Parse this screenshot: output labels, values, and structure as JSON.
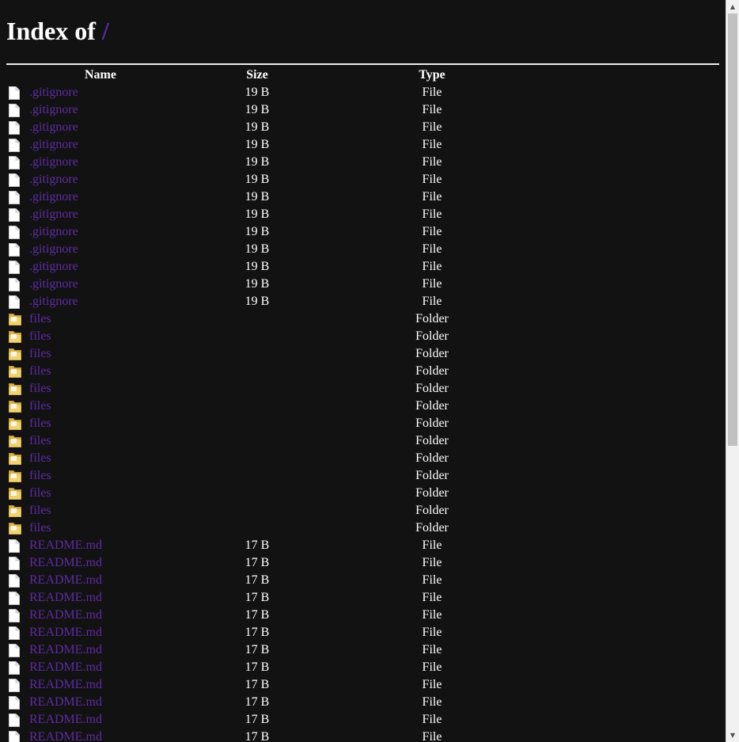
{
  "heading": {
    "prefix": "Index of ",
    "path": "/"
  },
  "columns": {
    "name": "Name",
    "size": "Size",
    "type": "Type"
  },
  "colors": {
    "background": "#121212",
    "link": "#5d2ca3",
    "text": "#ffffff",
    "folder_icon": "#f0d270"
  },
  "rows": [
    {
      "icon": "file-icon",
      "name": ".gitignore",
      "size": "19 B",
      "type": "File"
    },
    {
      "icon": "file-icon",
      "name": ".gitignore",
      "size": "19 B",
      "type": "File"
    },
    {
      "icon": "file-icon",
      "name": ".gitignore",
      "size": "19 B",
      "type": "File"
    },
    {
      "icon": "file-icon",
      "name": ".gitignore",
      "size": "19 B",
      "type": "File"
    },
    {
      "icon": "file-icon",
      "name": ".gitignore",
      "size": "19 B",
      "type": "File"
    },
    {
      "icon": "file-icon",
      "name": ".gitignore",
      "size": "19 B",
      "type": "File"
    },
    {
      "icon": "file-icon",
      "name": ".gitignore",
      "size": "19 B",
      "type": "File"
    },
    {
      "icon": "file-icon",
      "name": ".gitignore",
      "size": "19 B",
      "type": "File"
    },
    {
      "icon": "file-icon",
      "name": ".gitignore",
      "size": "19 B",
      "type": "File"
    },
    {
      "icon": "file-icon",
      "name": ".gitignore",
      "size": "19 B",
      "type": "File"
    },
    {
      "icon": "file-icon",
      "name": ".gitignore",
      "size": "19 B",
      "type": "File"
    },
    {
      "icon": "file-icon",
      "name": ".gitignore",
      "size": "19 B",
      "type": "File"
    },
    {
      "icon": "file-icon",
      "name": ".gitignore",
      "size": "19 B",
      "type": "File"
    },
    {
      "icon": "folder-icon",
      "name": "files",
      "size": "",
      "type": "Folder"
    },
    {
      "icon": "folder-icon",
      "name": "files",
      "size": "",
      "type": "Folder"
    },
    {
      "icon": "folder-icon",
      "name": "files",
      "size": "",
      "type": "Folder"
    },
    {
      "icon": "folder-icon",
      "name": "files",
      "size": "",
      "type": "Folder"
    },
    {
      "icon": "folder-icon",
      "name": "files",
      "size": "",
      "type": "Folder"
    },
    {
      "icon": "folder-icon",
      "name": "files",
      "size": "",
      "type": "Folder"
    },
    {
      "icon": "folder-icon",
      "name": "files",
      "size": "",
      "type": "Folder"
    },
    {
      "icon": "folder-icon",
      "name": "files",
      "size": "",
      "type": "Folder"
    },
    {
      "icon": "folder-icon",
      "name": "files",
      "size": "",
      "type": "Folder"
    },
    {
      "icon": "folder-icon",
      "name": "files",
      "size": "",
      "type": "Folder"
    },
    {
      "icon": "folder-icon",
      "name": "files",
      "size": "",
      "type": "Folder"
    },
    {
      "icon": "folder-icon",
      "name": "files",
      "size": "",
      "type": "Folder"
    },
    {
      "icon": "folder-icon",
      "name": "files",
      "size": "",
      "type": "Folder"
    },
    {
      "icon": "file-icon",
      "name": "README.md",
      "size": "17 B",
      "type": "File"
    },
    {
      "icon": "file-icon",
      "name": "README.md",
      "size": "17 B",
      "type": "File"
    },
    {
      "icon": "file-icon",
      "name": "README.md",
      "size": "17 B",
      "type": "File"
    },
    {
      "icon": "file-icon",
      "name": "README.md",
      "size": "17 B",
      "type": "File"
    },
    {
      "icon": "file-icon",
      "name": "README.md",
      "size": "17 B",
      "type": "File"
    },
    {
      "icon": "file-icon",
      "name": "README.md",
      "size": "17 B",
      "type": "File"
    },
    {
      "icon": "file-icon",
      "name": "README.md",
      "size": "17 B",
      "type": "File"
    },
    {
      "icon": "file-icon",
      "name": "README.md",
      "size": "17 B",
      "type": "File"
    },
    {
      "icon": "file-icon",
      "name": "README.md",
      "size": "17 B",
      "type": "File"
    },
    {
      "icon": "file-icon",
      "name": "README.md",
      "size": "17 B",
      "type": "File"
    },
    {
      "icon": "file-icon",
      "name": "README.md",
      "size": "17 B",
      "type": "File"
    },
    {
      "icon": "file-icon",
      "name": "README.md",
      "size": "17 B",
      "type": "File"
    }
  ],
  "scrollbar": {
    "up_arrow": "▲",
    "down_arrow": "▼",
    "position": 0
  }
}
